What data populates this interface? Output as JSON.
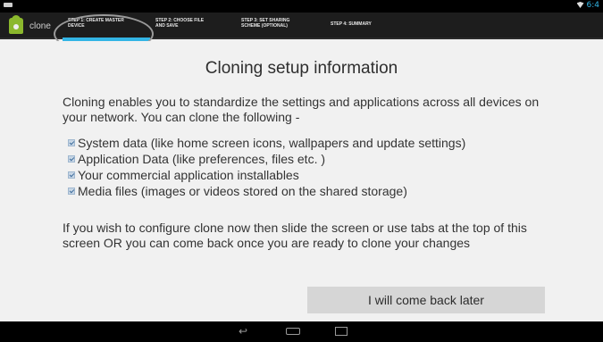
{
  "status_bar": {
    "time": "6:4"
  },
  "action_bar": {
    "app_title": "clone",
    "tabs": [
      {
        "line1": "STEP 1: CREATE MASTER",
        "line2": "DEVICE"
      },
      {
        "line1": "STEP 2: CHOOSE FILE",
        "line2": "AND SAVE"
      },
      {
        "line1": "STEP 3: SET SHARING",
        "line2": "SCHEME (OPTIONAL)"
      },
      {
        "line1": "STEP 4: SUMMARY",
        "line2": ""
      }
    ]
  },
  "main": {
    "heading": "Cloning setup information",
    "intro": "Cloning enables you to standardize the settings and applications across all devices on your network. You can clone the following -",
    "features": [
      "System data (like home screen icons, wallpapers and update settings)",
      "Application Data (like preferences, files etc. )",
      "Your commercial application installables",
      "Media files (images or videos stored on the shared storage)"
    ],
    "outro": "If you wish to configure clone now then slide the screen or use tabs at the top of this screen OR you can come back once you are ready to clone your changes",
    "later_button": "I will come back later"
  },
  "colors": {
    "accent": "#33b5e5",
    "action_bar": "#1d1d1d",
    "background": "#f1f1f1",
    "button": "#d6d6d6"
  },
  "icons": {
    "app": "android-icon",
    "wifi": "wifi-icon",
    "back": "back-icon",
    "home": "home-icon",
    "recent": "recent-apps-icon"
  }
}
